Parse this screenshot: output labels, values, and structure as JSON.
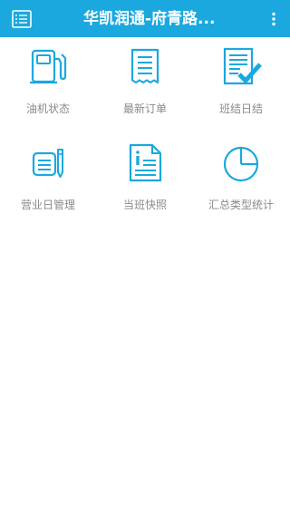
{
  "header": {
    "title": "华凯润通-府青路...",
    "menu_icon": "list-icon",
    "more_icon": "more-vert-icon",
    "bar_color": "#1aa8df"
  },
  "grid": {
    "icon_color": "#1aa8df",
    "label_color": "#8a8a8a",
    "items": [
      {
        "label": "油机状态",
        "icon": "fuel-pump-icon"
      },
      {
        "label": "最新订单",
        "icon": "receipt-icon"
      },
      {
        "label": "班结日结",
        "icon": "checked-document-icon"
      },
      {
        "label": "营业日管理",
        "icon": "notepad-pen-icon"
      },
      {
        "label": "当班快照",
        "icon": "info-document-icon"
      },
      {
        "label": "汇总类型统计",
        "icon": "pie-chart-icon"
      }
    ]
  }
}
